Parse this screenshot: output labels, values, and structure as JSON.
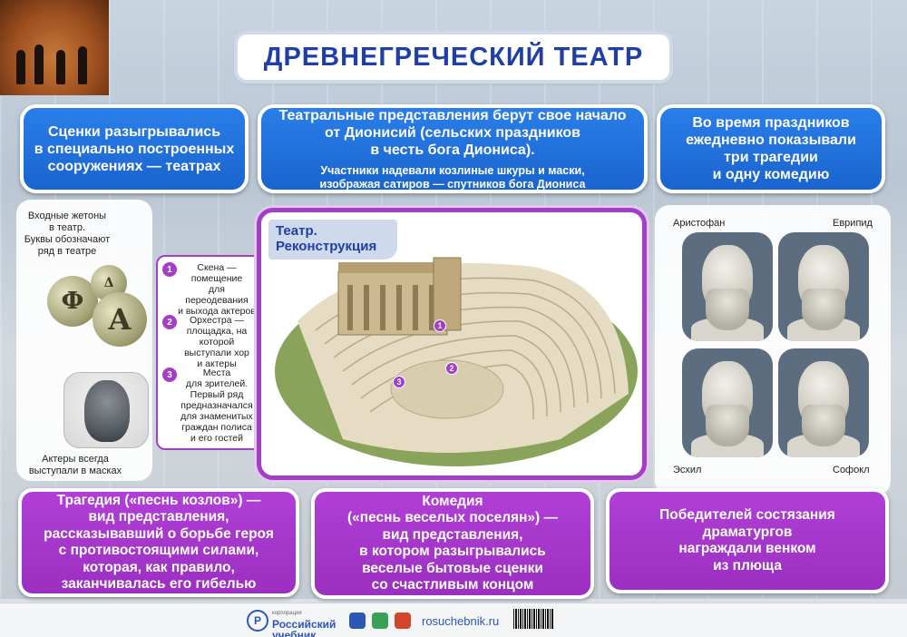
{
  "title": "ДРЕВНЕГРЕЧЕСКИЙ ТЕАТР",
  "top_boxes": {
    "left": [
      "Сценки разыгрывались",
      "в специально построенных",
      "сооружениях — театрах"
    ],
    "center_main": [
      "Театральные представления берут свое начало",
      "от Дионисий (сельских праздников",
      "в честь бога Диониса)."
    ],
    "center_sub": [
      "Участники надевали козлиные шкуры и маски,",
      "изображая сатиров — спутников бога Диониса"
    ],
    "right": [
      "Во время праздников",
      "ежедневно показывали",
      "три трагедии",
      "и одну комедию"
    ]
  },
  "left_panel": {
    "tokens_caption": [
      "Входные жетоны",
      "в театр.",
      "Буквы обозначают",
      "ряд в театре"
    ],
    "coin_letters": [
      "Ф",
      "Δ",
      "А"
    ],
    "mask_caption": [
      "Актеры всегда",
      "выступали в масках"
    ]
  },
  "legend": [
    {
      "num": "1",
      "lines": [
        "Скена —",
        "помещение",
        "для переодевания",
        "и выхода актеров"
      ]
    },
    {
      "num": "2",
      "lines": [
        "Орхестра —",
        "площадка, на которой",
        "выступали хор",
        "и актеры"
      ]
    },
    {
      "num": "3",
      "lines": [
        "Места",
        "для зрителей.",
        "Первый ряд",
        "предназначался",
        "для знаменитых",
        "граждан полиса",
        "и его гостей"
      ]
    }
  ],
  "theatre": {
    "label": [
      "Театр.",
      "Реконструкция"
    ],
    "markers": [
      "1",
      "2",
      "3"
    ]
  },
  "playwrights": [
    "Аристофан",
    "Еврипид",
    "Эсхил",
    "Софокл"
  ],
  "bottom_boxes": {
    "tragedy": [
      "Трагедия («песнь козлов») —",
      "вид представления,",
      "рассказывавший о борьбе героя",
      "с противостоящими силами,",
      "которая, как правило,",
      "заканчивалась его гибелью"
    ],
    "comedy": [
      "Комедия",
      "(«песнь веселых поселян») —",
      "вид представления,",
      "в котором разыгрывались",
      "веселые бытовые сценки",
      "со счастливым концом"
    ],
    "winners": [
      "Победителей состязания",
      "драматургов",
      "награждали венком",
      "из плюща"
    ]
  },
  "footer": {
    "logo_letter": "Р",
    "brand_small": "корпорация",
    "brand_line1": "Российский",
    "brand_line2": "учебник",
    "site": "rosuchebnik.ru"
  },
  "colors": {
    "blue": "#1f6ee0",
    "purple": "#a23fc4",
    "title": "#1f3fa6"
  }
}
